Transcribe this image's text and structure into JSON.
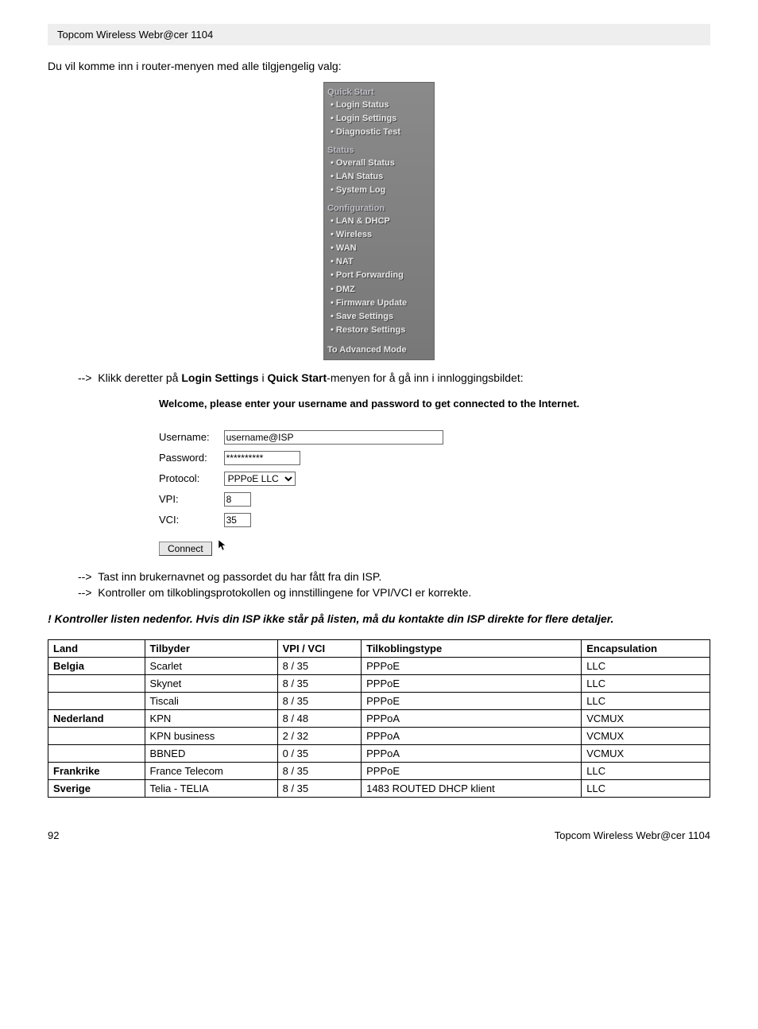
{
  "header": "Topcom Wireless Webr@cer 1104",
  "intro": "Du vil komme inn i router-menyen med alle tilgjengelig valg:",
  "menu": {
    "groups": [
      {
        "title": "Quick Start",
        "items": [
          "Login Status",
          "Login Settings",
          "Diagnostic Test"
        ]
      },
      {
        "title": "Status",
        "items": [
          "Overall Status",
          "LAN Status",
          "System Log"
        ]
      },
      {
        "title": "Configuration",
        "items": [
          "LAN & DHCP",
          "Wireless",
          "WAN",
          "NAT",
          "Port Forwarding",
          "DMZ",
          "Firmware Update",
          "Save Settings",
          "Restore Settings"
        ]
      }
    ],
    "footer": "To Advanced Mode"
  },
  "step1": {
    "arrow": "-->",
    "pre": "Klikk deretter på ",
    "b1": "Login Settings",
    "mid": " i ",
    "b2": "Quick Start",
    "post": "-menyen for å gå inn i innloggingsbildet:"
  },
  "login": {
    "welcome": "Welcome, please enter your username and password to get connected to the Internet.",
    "labels": {
      "username": "Username:",
      "password": "Password:",
      "protocol": "Protocol:",
      "vpi": "VPI:",
      "vci": "VCI:"
    },
    "values": {
      "username": "username@ISP",
      "password": "**********",
      "protocol": "PPPoE LLC",
      "vpi": "8",
      "vci": "35"
    },
    "connect": "Connect"
  },
  "step2a": {
    "arrow": "-->",
    "text": "Tast inn brukernavnet og passordet du har fått fra din ISP."
  },
  "step2b": {
    "arrow": "-->",
    "text": "Kontroller om tilkoblingsprotokollen og innstillingene for VPI/VCI er korrekte."
  },
  "notice": "! Kontroller listen nedenfor. Hvis din ISP ikke står på listen, må du kontakte din ISP direkte for flere detaljer.",
  "table": {
    "headers": [
      "Land",
      "Tilbyder",
      "VPI / VCI",
      "Tilkoblingstype",
      "Encapsulation"
    ],
    "rows": [
      {
        "country": "Belgia",
        "provider": "Scarlet",
        "vpivci": "8 / 35",
        "type": "PPPoE",
        "encap": "LLC"
      },
      {
        "country": "",
        "provider": "Skynet",
        "vpivci": "8 / 35",
        "type": "PPPoE",
        "encap": "LLC"
      },
      {
        "country": "",
        "provider": "Tiscali",
        "vpivci": "8 / 35",
        "type": "PPPoE",
        "encap": "LLC"
      },
      {
        "country": "Nederland",
        "provider": "KPN",
        "vpivci": "8 / 48",
        "type": "PPPoA",
        "encap": "VCMUX"
      },
      {
        "country": "",
        "provider": "KPN business",
        "vpivci": "2 / 32",
        "type": "PPPoA",
        "encap": "VCMUX"
      },
      {
        "country": "",
        "provider": "BBNED",
        "vpivci": "0 / 35",
        "type": "PPPoA",
        "encap": "VCMUX"
      },
      {
        "country": "Frankrike",
        "provider": "France Telecom",
        "vpivci": "8 / 35",
        "type": "PPPoE",
        "encap": "LLC"
      },
      {
        "country": "Sverige",
        "provider": "Telia - TELIA",
        "vpivci": "8 / 35",
        "type": "1483 ROUTED DHCP klient",
        "encap": "LLC"
      }
    ]
  },
  "footer": {
    "page": "92",
    "title": "Topcom Wireless Webr@cer 1104"
  }
}
